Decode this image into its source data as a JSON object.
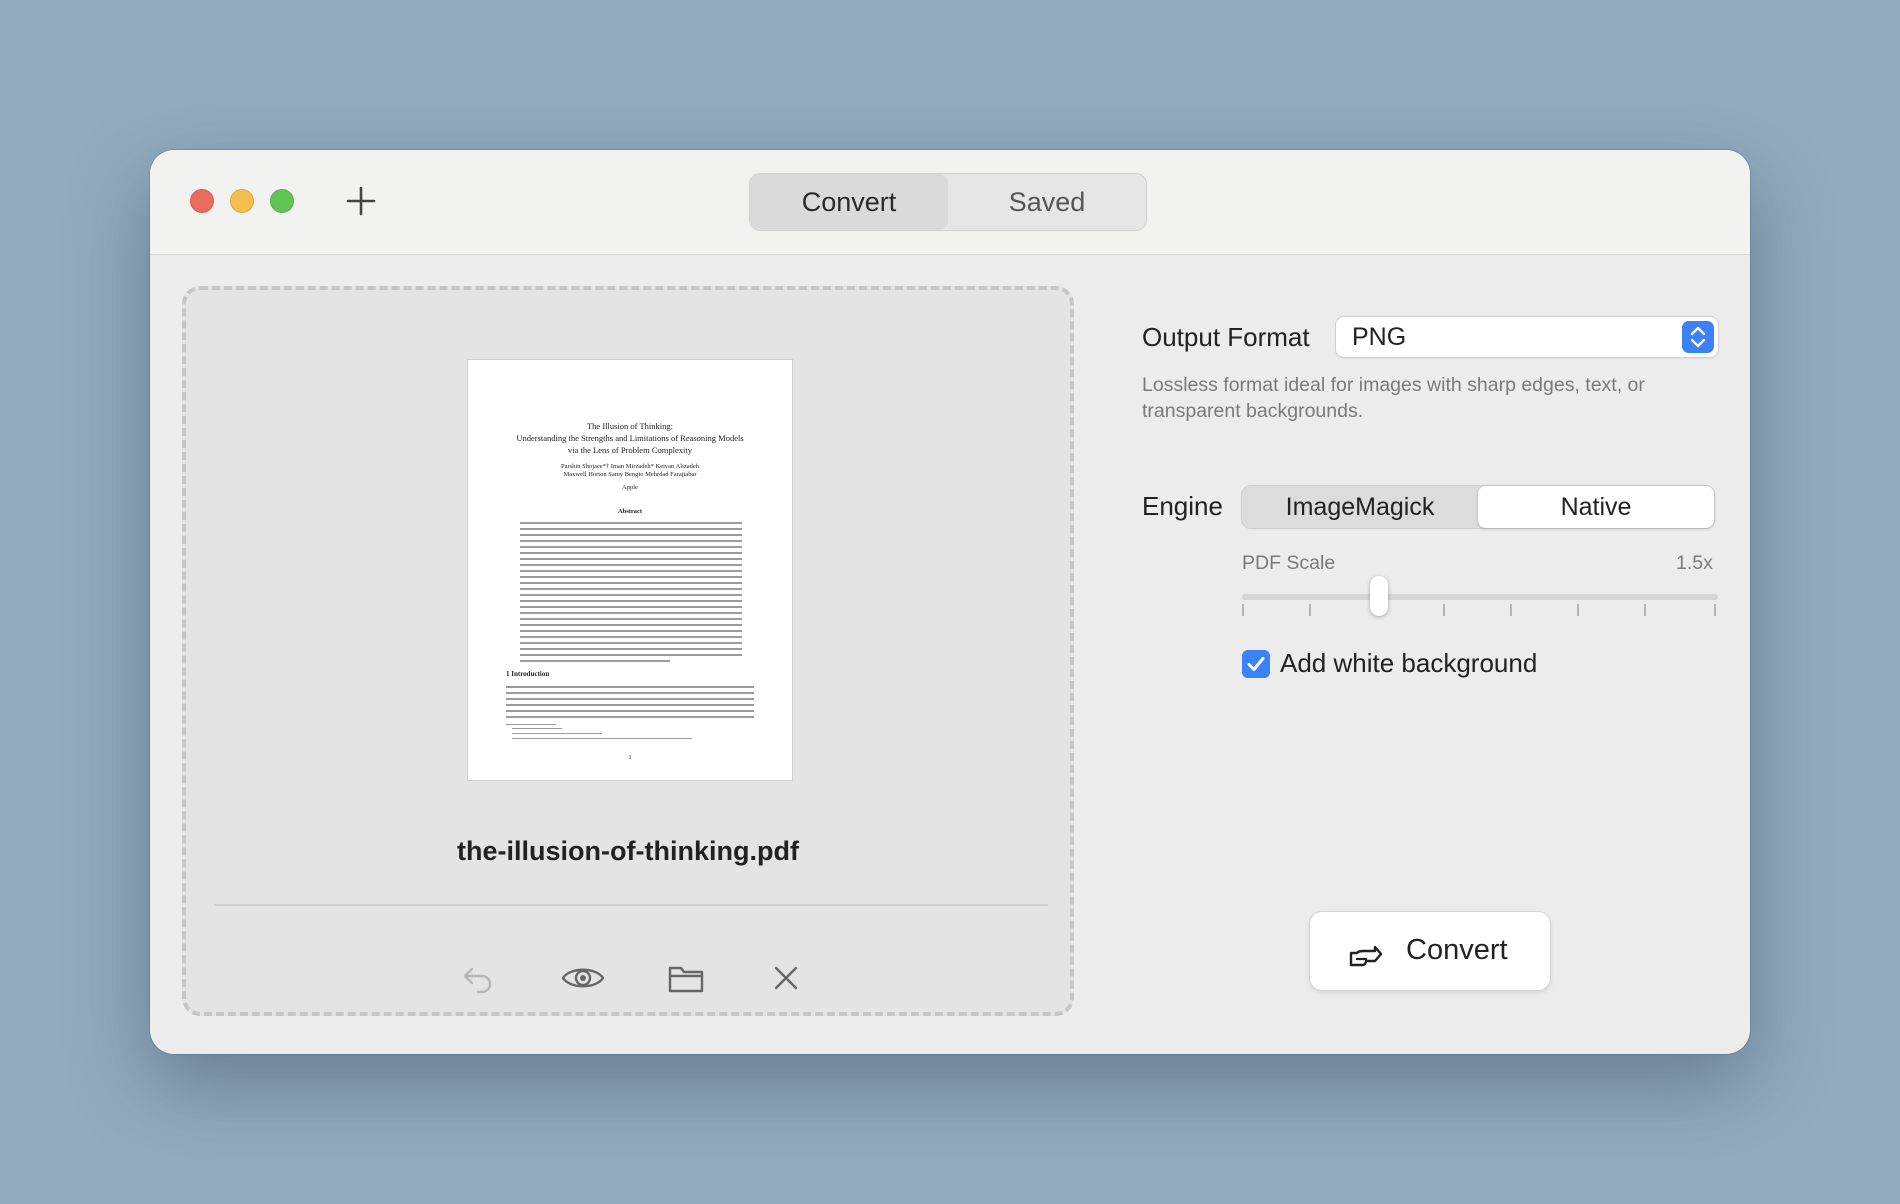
{
  "window": {
    "tabs": [
      {
        "label": "Convert",
        "selected": true
      },
      {
        "label": "Saved",
        "selected": false
      }
    ]
  },
  "preview": {
    "document": {
      "title_lines": [
        "The Illusion of Thinking:",
        "Understanding the Strengths and Limitations of Reasoning Models",
        "via the Lens of Problem Complexity"
      ],
      "authors_line1": "Parshin Shojaee*†   Iman Mirzadeh*   Keivan Alizadeh",
      "authors_line2": "Maxwell Horton   Samy Bengio   Mehrdad Farajtabar",
      "affiliation": "Apple",
      "abstract_heading": "Abstract",
      "section_heading": "1   Introduction",
      "page_number": "1"
    },
    "filename": "the-illusion-of-thinking.pdf",
    "actions": [
      "undo-icon",
      "eye-icon",
      "folder-icon",
      "close-icon"
    ]
  },
  "settings": {
    "output_format_label": "Output Format",
    "output_format_value": "PNG",
    "format_description": "Lossless format ideal for images with sharp edges, text, or transparent backgrounds.",
    "engine_label": "Engine",
    "engine_options": [
      "ImageMagick",
      "Native"
    ],
    "engine_selected": "Native",
    "pdf_scale_label": "PDF Scale",
    "pdf_scale_value": "1.5x",
    "add_white_background_label": "Add white background",
    "add_white_background_checked": true,
    "convert_button_label": "Convert"
  },
  "colors": {
    "accent": "#3b82f6",
    "close": "#ec6a5e",
    "minimize": "#f4bf4f",
    "zoom": "#61c554"
  }
}
